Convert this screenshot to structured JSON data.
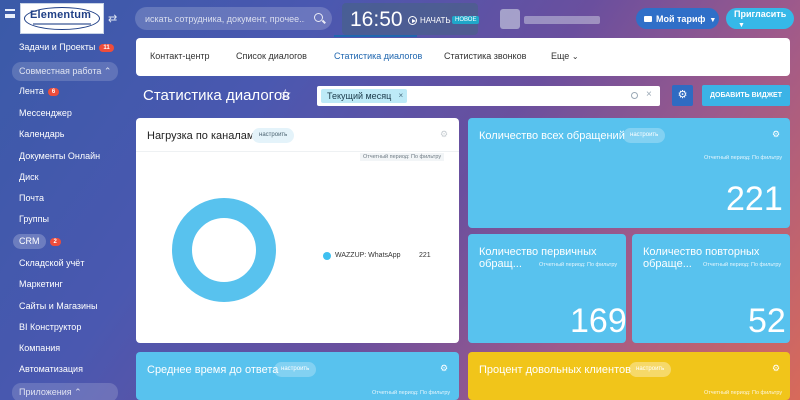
{
  "topbar": {
    "logo_text": "Elementum",
    "search_placeholder": "искать сотрудника, документ, прочее...",
    "clock_time": "16:50",
    "clock_start": "НАЧАТЬ",
    "clock_badge": "НОВОЕ",
    "tariff_label": "Мой тариф",
    "invite_label": "Пригласить"
  },
  "sidebar": {
    "items": [
      {
        "label": "Задачи и Проекты",
        "badge": "11"
      },
      {
        "label": "Совместная работа"
      },
      {
        "label": "Лента",
        "badge": "6"
      },
      {
        "label": "Мессенджер"
      },
      {
        "label": "Календарь"
      },
      {
        "label": "Документы Онлайн"
      },
      {
        "label": "Диск"
      },
      {
        "label": "Почта"
      },
      {
        "label": "Группы"
      },
      {
        "label": "CRM",
        "badge": "2"
      },
      {
        "label": "Складской учёт"
      },
      {
        "label": "Маркетинг"
      },
      {
        "label": "Сайты и Магазины"
      },
      {
        "label": "BI Конструктор"
      },
      {
        "label": "Компания"
      },
      {
        "label": "Автоматизация"
      },
      {
        "label": "Приложения"
      }
    ]
  },
  "tabs": [
    {
      "label": "Контакт-центр"
    },
    {
      "label": "Список диалогов"
    },
    {
      "label": "Статистика диалогов",
      "active": true
    },
    {
      "label": "Статистика звонков"
    },
    {
      "label": "Еще"
    }
  ],
  "page": {
    "title": "Статистика диалогов",
    "filter_tag": "Текущий месяц",
    "add_widget": "ДОБАВИТЬ ВИДЖЕТ"
  },
  "widgets": {
    "config_label": "настроить",
    "period_label": "Отчетный период: По фильтру",
    "channels": {
      "title": "Нагрузка по каналам",
      "legend_label": "WAZZUP: WhatsApp",
      "legend_value": "221"
    },
    "total": {
      "title": "Количество всех обращений",
      "value": "221"
    },
    "first": {
      "title": "Количество первичных обращ...",
      "value": "169"
    },
    "repeat": {
      "title": "Количество повторных обраще...",
      "value": "52"
    },
    "response": {
      "title": "Среднее время до ответа"
    },
    "satisfied": {
      "title": "Процент довольных клиентов"
    }
  },
  "chart_data": {
    "type": "pie",
    "categories": [
      "WAZZUP: WhatsApp"
    ],
    "values": [
      221
    ],
    "colors": [
      "#58c2ee"
    ]
  },
  "colors": {
    "accent_blue": "#2067b0",
    "widget_blue": "#58c2ee",
    "widget_yellow": "#f1c51a",
    "badge_red": "#ee4d3b"
  }
}
